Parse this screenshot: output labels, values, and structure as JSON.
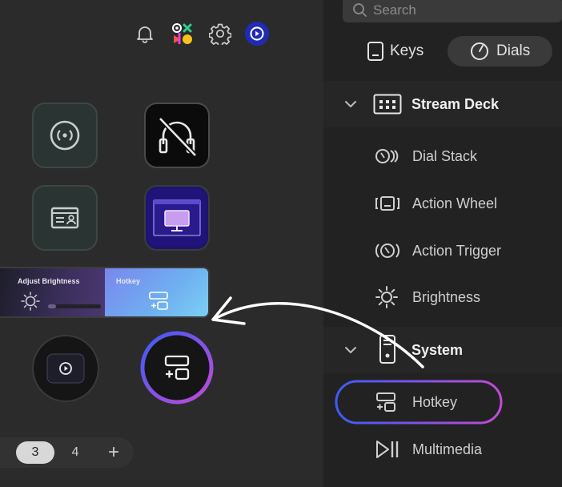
{
  "colors": {
    "accent_blue": "#3d5cf5",
    "accent_purple": "#c34ad6",
    "panel_left": "#2b2b2b",
    "panel_right": "#222222"
  },
  "topbar": {
    "icons": [
      "bell-icon",
      "marketplace-icon",
      "settings-icon",
      "elgato-logo-icon"
    ]
  },
  "deck": {
    "tiles": [
      {
        "name": "broadcast-icon"
      },
      {
        "name": "headphones-muted-icon"
      },
      {
        "name": "id-card-icon"
      },
      {
        "name": "monitor-icon"
      }
    ],
    "dials": [
      {
        "label": "Adjust Brightness",
        "icon": "sun-icon"
      },
      {
        "label": "Hotkey",
        "icon": "hotkey-icon"
      }
    ],
    "knobs": [
      "elgato-logo-icon",
      "hotkey-icon"
    ]
  },
  "pager": {
    "pages": [
      "3",
      "4"
    ],
    "current": "3",
    "add_label": "+"
  },
  "search": {
    "placeholder": "Search"
  },
  "tabs": [
    {
      "label": "Keys",
      "icon": "key-icon",
      "active": false
    },
    {
      "label": "Dials",
      "icon": "dial-icon",
      "active": true
    }
  ],
  "categories": [
    {
      "label": "Stream Deck",
      "icon": "stream-deck-icon",
      "items": [
        {
          "label": "Dial Stack",
          "icon": "dial-stack-icon"
        },
        {
          "label": "Action Wheel",
          "icon": "action-wheel-icon"
        },
        {
          "label": "Action Trigger",
          "icon": "action-trigger-icon"
        },
        {
          "label": "Brightness",
          "icon": "sun-icon"
        }
      ]
    },
    {
      "label": "System",
      "icon": "system-device-icon",
      "items": [
        {
          "label": "Hotkey",
          "icon": "hotkey-icon",
          "highlighted": true
        },
        {
          "label": "Multimedia",
          "icon": "play-pause-icon"
        }
      ]
    }
  ]
}
